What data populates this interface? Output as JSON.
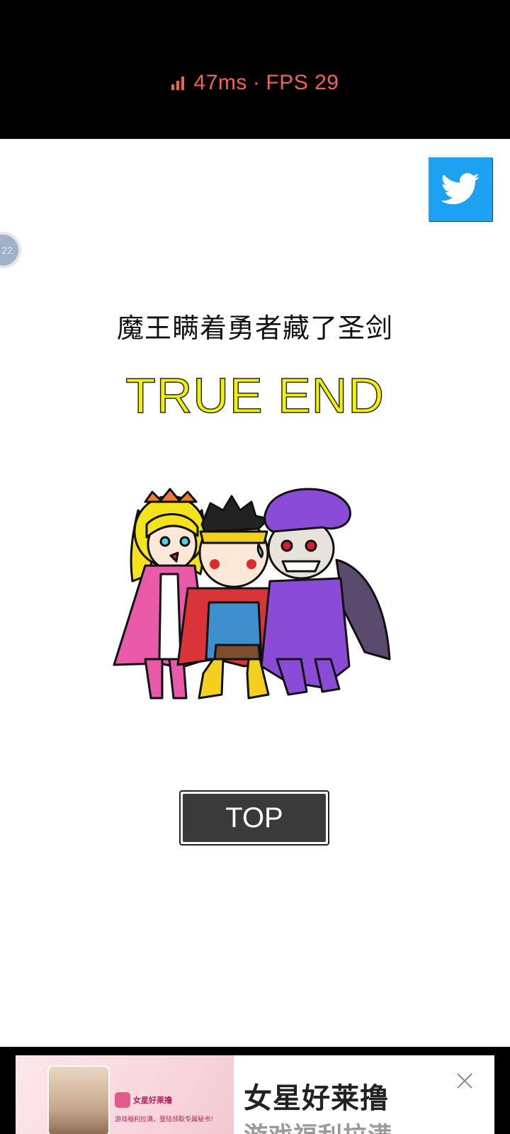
{
  "status_overlay": {
    "latency": "47ms",
    "separator": "·",
    "fps": "FPS 29"
  },
  "float_ball": {
    "label": "22"
  },
  "share": {
    "icon": "twitter-icon"
  },
  "ending": {
    "title": "魔王瞒着勇者藏了圣剑",
    "result": "TRUE END",
    "result_color": "#f2f200"
  },
  "illustration": {
    "characters": [
      "princess",
      "hero",
      "demon-lord"
    ]
  },
  "top_button": {
    "label": "TOP"
  },
  "ad": {
    "app_name": "女星好莱撸",
    "title": "女星好莱撸",
    "subtitle": "游戏福利拉满",
    "mini_desc": "游戏福利拉满，登陆领取专属秘书！",
    "close_icon": "close-icon"
  },
  "colors": {
    "twitter": "#1da1f2",
    "perf_text": "#f2644f",
    "button_bg": "#3a3a3a"
  }
}
